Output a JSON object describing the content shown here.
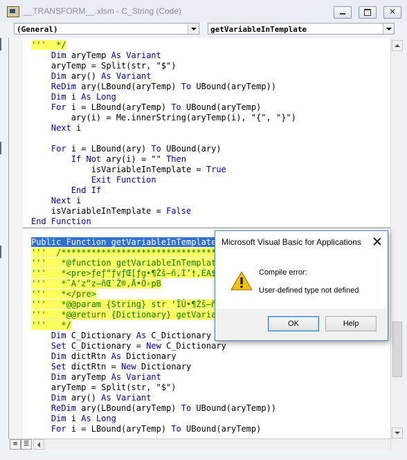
{
  "window": {
    "title": "__TRANSFORM__.xlsm - C_String (Code)"
  },
  "toolbar": {
    "object_combo": "(General)",
    "procedure_combo": "getVariableInTemplate"
  },
  "code_lines_top": [
    {
      "parts": [
        {
          "t": "'''  */",
          "c": "cm"
        }
      ]
    },
    {
      "parts": [
        {
          "t": "    ",
          "c": "tx"
        },
        {
          "t": "Dim",
          "c": "kw"
        },
        {
          "t": " aryTemp ",
          "c": "tx"
        },
        {
          "t": "As Variant",
          "c": "kw"
        }
      ]
    },
    {
      "parts": [
        {
          "t": "    aryTemp = Split(str, \"$\")",
          "c": "tx"
        }
      ]
    },
    {
      "parts": [
        {
          "t": "    ",
          "c": "tx"
        },
        {
          "t": "Dim",
          "c": "kw"
        },
        {
          "t": " ary() ",
          "c": "tx"
        },
        {
          "t": "As Variant",
          "c": "kw"
        }
      ]
    },
    {
      "parts": [
        {
          "t": "    ",
          "c": "tx"
        },
        {
          "t": "ReDim",
          "c": "kw"
        },
        {
          "t": " ary(LBound(aryTemp) ",
          "c": "tx"
        },
        {
          "t": "To",
          "c": "kw"
        },
        {
          "t": " UBound(aryTemp))",
          "c": "tx"
        }
      ]
    },
    {
      "parts": [
        {
          "t": "    ",
          "c": "tx"
        },
        {
          "t": "Dim",
          "c": "kw"
        },
        {
          "t": " i ",
          "c": "tx"
        },
        {
          "t": "As Long",
          "c": "kw"
        }
      ]
    },
    {
      "parts": [
        {
          "t": "    ",
          "c": "tx"
        },
        {
          "t": "For",
          "c": "kw"
        },
        {
          "t": " i = LBound(aryTemp) ",
          "c": "tx"
        },
        {
          "t": "To",
          "c": "kw"
        },
        {
          "t": " UBound(aryTemp)",
          "c": "tx"
        }
      ]
    },
    {
      "parts": [
        {
          "t": "        ary(i) = Me.innerString(aryTemp(i), \"{\", \"}\")",
          "c": "tx"
        }
      ]
    },
    {
      "parts": [
        {
          "t": "    ",
          "c": "tx"
        },
        {
          "t": "Next",
          "c": "kw"
        },
        {
          "t": " i",
          "c": "tx"
        }
      ]
    },
    {
      "parts": [
        {
          "t": "",
          "c": "tx"
        }
      ]
    },
    {
      "parts": [
        {
          "t": "    ",
          "c": "tx"
        },
        {
          "t": "For",
          "c": "kw"
        },
        {
          "t": " i = LBound(ary) ",
          "c": "tx"
        },
        {
          "t": "To",
          "c": "kw"
        },
        {
          "t": " UBound(ary)",
          "c": "tx"
        }
      ]
    },
    {
      "parts": [
        {
          "t": "        ",
          "c": "tx"
        },
        {
          "t": "If Not",
          "c": "kw"
        },
        {
          "t": " ary(i) = \"\" ",
          "c": "tx"
        },
        {
          "t": "Then",
          "c": "kw"
        }
      ]
    },
    {
      "parts": [
        {
          "t": "            isVariableInTemplate = ",
          "c": "tx"
        },
        {
          "t": "True",
          "c": "kw"
        }
      ]
    },
    {
      "parts": [
        {
          "t": "            ",
          "c": "tx"
        },
        {
          "t": "Exit Function",
          "c": "kw"
        }
      ]
    },
    {
      "parts": [
        {
          "t": "        ",
          "c": "tx"
        },
        {
          "t": "End If",
          "c": "kw"
        }
      ]
    },
    {
      "parts": [
        {
          "t": "    ",
          "c": "tx"
        },
        {
          "t": "Next",
          "c": "kw"
        },
        {
          "t": " i",
          "c": "tx"
        }
      ]
    },
    {
      "parts": [
        {
          "t": "    isVariableInTemplate = ",
          "c": "tx"
        },
        {
          "t": "False",
          "c": "kw"
        }
      ]
    },
    {
      "parts": [
        {
          "t": "End Function",
          "c": "kw"
        }
      ]
    }
  ],
  "code_lines_bottom": [
    {
      "parts": [
        {
          "t": "Public Function getVariableInTemplate(",
          "c": "sel"
        }
      ]
    },
    {
      "parts": [
        {
          "t": "'''  /************************************",
          "c": "cm"
        }
      ]
    },
    {
      "parts": [
        {
          "t": "'''   *@function getVariableInTemplate",
          "c": "cm"
        }
      ]
    },
    {
      "parts": [
        {
          "t": "'''   *<pre>ƒeƒ“ƒvƒŒ[ƒg•¶Žš—ñ,Ì’†,ÉA${x",
          "c": "cm"
        }
      ]
    },
    {
      "parts": [
        {
          "t": "'''   *˜A‘z”z—ñŒ`Ž®,Å•Ô‹pB",
          "c": "cm"
        }
      ]
    },
    {
      "parts": [
        {
          "t": "'''   *</pre>",
          "c": "cm"
        }
      ]
    },
    {
      "parts": [
        {
          "t": "'''   *@@param {String} str ‘ÎÛ•¶Žš—ñ",
          "c": "cm"
        }
      ]
    },
    {
      "parts": [
        {
          "t": "'''   *@@return {Dictionary} getVariabl",
          "c": "cm"
        }
      ]
    },
    {
      "parts": [
        {
          "t": "'''   */",
          "c": "cm"
        }
      ]
    },
    {
      "parts": [
        {
          "t": "    ",
          "c": "tx"
        },
        {
          "t": "Dim",
          "c": "kw"
        },
        {
          "t": " C_Dictionary ",
          "c": "tx"
        },
        {
          "t": "As",
          "c": "kw"
        },
        {
          "t": " C_Dictionary",
          "c": "tx"
        }
      ]
    },
    {
      "parts": [
        {
          "t": "    ",
          "c": "tx"
        },
        {
          "t": "Set",
          "c": "kw"
        },
        {
          "t": " C_Dictionary = ",
          "c": "tx"
        },
        {
          "t": "New",
          "c": "kw"
        },
        {
          "t": " C_Dictionary",
          "c": "tx"
        }
      ]
    },
    {
      "parts": [
        {
          "t": "    ",
          "c": "tx"
        },
        {
          "t": "Dim",
          "c": "kw"
        },
        {
          "t": " dictRtn ",
          "c": "tx"
        },
        {
          "t": "As",
          "c": "kw"
        },
        {
          "t": " Dictionary",
          "c": "tx"
        }
      ]
    },
    {
      "parts": [
        {
          "t": "    ",
          "c": "tx"
        },
        {
          "t": "Set",
          "c": "kw"
        },
        {
          "t": " dictRtn = ",
          "c": "tx"
        },
        {
          "t": "New",
          "c": "kw"
        },
        {
          "t": " Dictionary",
          "c": "tx"
        }
      ]
    },
    {
      "parts": [
        {
          "t": "    ",
          "c": "tx"
        },
        {
          "t": "Dim",
          "c": "kw"
        },
        {
          "t": " aryTemp ",
          "c": "tx"
        },
        {
          "t": "As Variant",
          "c": "kw"
        }
      ]
    },
    {
      "parts": [
        {
          "t": "    aryTemp = Split(str, \"$\")",
          "c": "tx"
        }
      ]
    },
    {
      "parts": [
        {
          "t": "    ",
          "c": "tx"
        },
        {
          "t": "Dim",
          "c": "kw"
        },
        {
          "t": " ary() ",
          "c": "tx"
        },
        {
          "t": "As Variant",
          "c": "kw"
        }
      ]
    },
    {
      "parts": [
        {
          "t": "    ",
          "c": "tx"
        },
        {
          "t": "ReDim",
          "c": "kw"
        },
        {
          "t": " ary(LBound(aryTemp) ",
          "c": "tx"
        },
        {
          "t": "To",
          "c": "kw"
        },
        {
          "t": " UBound(aryTemp))",
          "c": "tx"
        }
      ]
    },
    {
      "parts": [
        {
          "t": "    ",
          "c": "tx"
        },
        {
          "t": "Dim",
          "c": "kw"
        },
        {
          "t": " i ",
          "c": "tx"
        },
        {
          "t": "As Long",
          "c": "kw"
        }
      ]
    },
    {
      "parts": [
        {
          "t": "    ",
          "c": "tx"
        },
        {
          "t": "For",
          "c": "kw"
        },
        {
          "t": " i = LBound(aryTemp) ",
          "c": "tx"
        },
        {
          "t": "To",
          "c": "kw"
        },
        {
          "t": " UBound(aryTemp)",
          "c": "tx"
        }
      ]
    }
  ],
  "dialog": {
    "title": "Microsoft Visual Basic for Applications",
    "message_title": "Compile error:",
    "message_body": "User-defined type not defined",
    "ok_label": "OK",
    "help_label": "Help",
    "icon": "warning-icon"
  },
  "colors": {
    "keyword": "#0000c0",
    "comment": "#008000",
    "comment_highlight": "#ffff60",
    "selection": "#3070d0"
  }
}
